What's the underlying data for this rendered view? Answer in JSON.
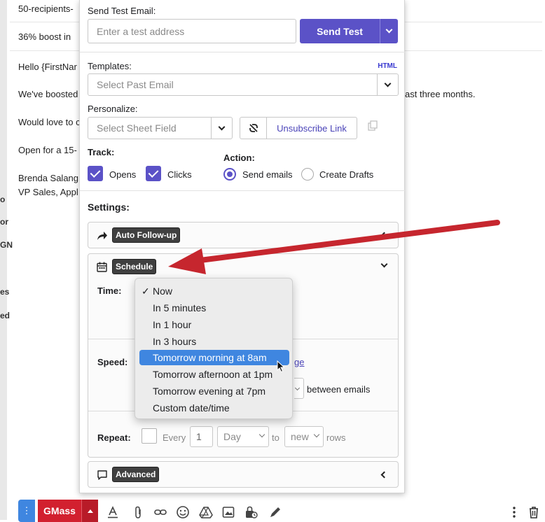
{
  "background": {
    "lines": [
      "50-recipients-",
      "36% boost in",
      "Hello {FirstNar",
      "We've boosted",
      "Would love to c",
      "Open for a 15-",
      "Brenda Salang",
      "VP Sales, Appl"
    ],
    "continuation": "ast three months.",
    "slivers": [
      "o",
      "or",
      "GN",
      "es",
      "ed"
    ]
  },
  "panel": {
    "test_email": {
      "label": "Send Test Email:",
      "placeholder": "Enter a test address",
      "button": "Send Test"
    },
    "templates": {
      "label": "Templates:",
      "html_link": "HTML",
      "placeholder": "Select Past Email"
    },
    "personalize": {
      "label": "Personalize:",
      "placeholder": "Select Sheet Field",
      "unsubscribe": "Unsubscribe Link"
    },
    "track": {
      "label": "Track:",
      "opens": "Opens",
      "clicks": "Clicks",
      "opens_checked": true,
      "clicks_checked": true
    },
    "action": {
      "label": "Action:",
      "send_emails": "Send emails",
      "create_drafts": "Create Drafts",
      "selected": "Send emails"
    },
    "settings_label": "Settings:",
    "auto_followup": "Auto Follow-up",
    "schedule": {
      "title": "Schedule",
      "time_label": "Time:",
      "speed_label": "Speed:",
      "speed_link_tail": "ge",
      "between_emails": "between emails",
      "repeat_label": "Repeat:",
      "every": "Every",
      "every_value": "1",
      "unit": "Day",
      "to": "to",
      "new": "new",
      "rows": "rows"
    },
    "advanced": "Advanced"
  },
  "time_dropdown": {
    "options": [
      "Now",
      "In 5 minutes",
      "In 1 hour",
      "In 3 hours",
      "Tomorrow morning at 8am",
      "Tomorrow afternoon at 1pm",
      "Tomorrow evening at 7pm",
      "Custom date/time"
    ],
    "checked": "Now",
    "highlighted": "Tomorrow morning at 8am"
  },
  "toolbar": {
    "gmass_label": "GMass"
  },
  "colors": {
    "accent": "#5b52c7",
    "highlight": "#3f86e0",
    "gmass_red": "#d2202f",
    "arrow": "#c6262e"
  }
}
